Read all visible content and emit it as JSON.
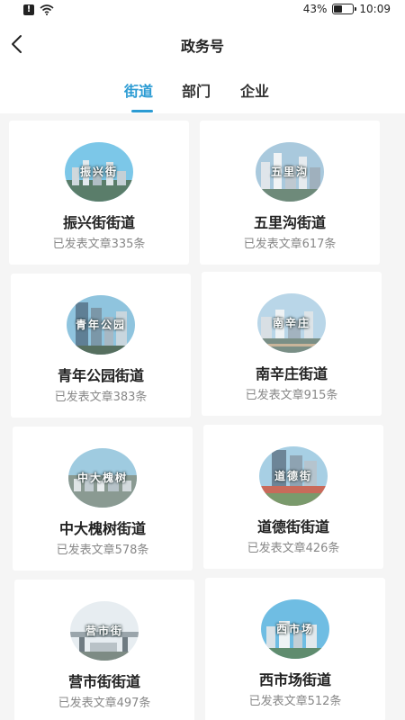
{
  "status_bar": {
    "battery_percent": "43%",
    "battery_level": 0.43,
    "time": "10:09",
    "icons": [
      "alert-icon",
      "wifi-icon",
      "battery-icon"
    ]
  },
  "header": {
    "title": "政务号",
    "back_icon": "chevron-left-icon"
  },
  "tabs": [
    {
      "label": "街道",
      "active": true
    },
    {
      "label": "部门",
      "active": false
    },
    {
      "label": "企业",
      "active": false
    }
  ],
  "accent_color": "#2b9bd3",
  "cards": [
    {
      "thumb_text": "振兴街",
      "name": "振兴街街道",
      "count_text": "已发表文章335条"
    },
    {
      "thumb_text": "五里沟",
      "name": "五里沟街道",
      "count_text": "已发表文章617条"
    },
    {
      "thumb_text": "青年公园",
      "name": "青年公园街道",
      "count_text": "已发表文章383条"
    },
    {
      "thumb_text": "南辛庄",
      "name": "南辛庄街道",
      "count_text": "已发表文章915条"
    },
    {
      "thumb_text": "中大槐树",
      "name": "中大槐树街道",
      "count_text": "已发表文章578条"
    },
    {
      "thumb_text": "道德街",
      "name": "道德街街道",
      "count_text": "已发表文章426条"
    },
    {
      "thumb_text": "营市街",
      "name": "营市街街道",
      "count_text": "已发表文章497条"
    },
    {
      "thumb_text": "西市场",
      "name": "西市场街道",
      "count_text": "已发表文章512条"
    }
  ]
}
